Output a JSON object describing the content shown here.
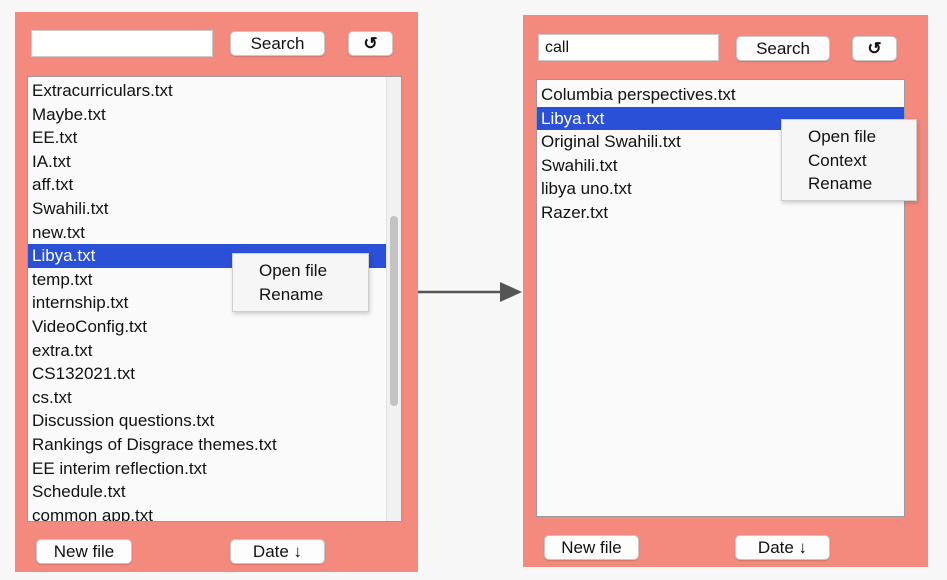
{
  "left_panel": {
    "search": {
      "value": "",
      "placeholder": ""
    },
    "search_label": "Search",
    "refresh_icon": "↺",
    "files": [
      "Extracurriculars.txt",
      "Maybe.txt",
      "EE.txt",
      "IA.txt",
      "aff.txt",
      "Swahili.txt",
      "new.txt",
      "Libya.txt",
      "temp.txt",
      "internship.txt",
      "VideoConfig.txt",
      "extra.txt",
      "CS132021.txt",
      "cs.txt",
      "Discussion questions.txt",
      "Rankings of Disgrace themes.txt",
      "EE interim reflection.txt",
      "Schedule.txt",
      "common app.txt"
    ],
    "selected_index": 7,
    "context_menu": [
      "Open file",
      "Rename"
    ],
    "new_file_label": "New file",
    "sort_label": "Date ↓",
    "scroll_position": 0.55
  },
  "right_panel": {
    "search": {
      "value": "call",
      "placeholder": ""
    },
    "search_label": "Search",
    "refresh_icon": "↺",
    "files": [
      "Columbia perspectives.txt",
      "Libya.txt",
      "Original Swahili.txt",
      "Swahili.txt",
      "libya uno.txt",
      "Razer.txt"
    ],
    "selected_index": 1,
    "context_menu": [
      "Open file",
      "Context",
      "Rename"
    ],
    "new_file_label": "New file",
    "sort_label": "Date ↓"
  },
  "colors": {
    "panel_bg": "#f4897d",
    "selection": "#2a50d8",
    "arrow": "#555555"
  }
}
